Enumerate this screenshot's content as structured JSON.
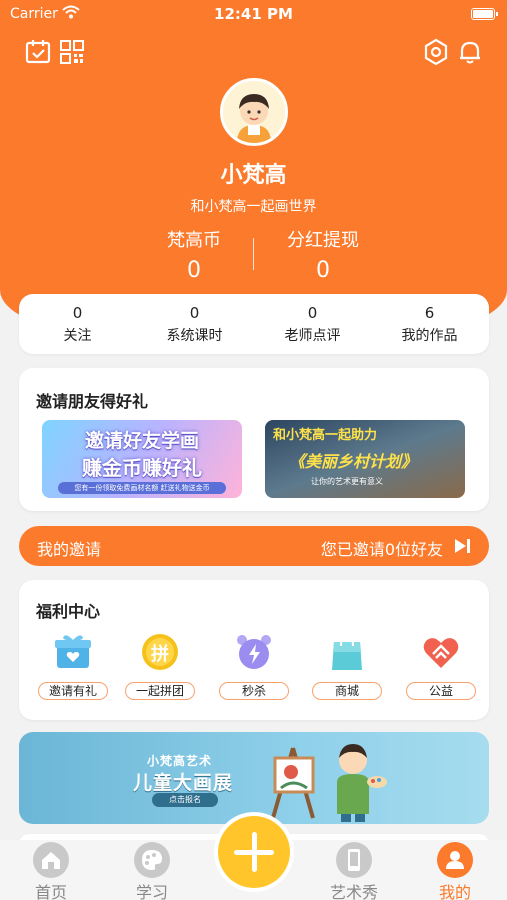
{
  "status_bar": {
    "carrier": "Carrier",
    "time": "12:41 PM"
  },
  "header": {
    "username": "小梵高",
    "slogan": "和小梵高一起画世界",
    "coins_label": "梵高币",
    "coins_value": "0",
    "dividend_label": "分红提现",
    "dividend_value": "0"
  },
  "stats": [
    {
      "value": "0",
      "label": "关注"
    },
    {
      "value": "0",
      "label": "系统课时"
    },
    {
      "value": "0",
      "label": "老师点评"
    },
    {
      "value": "6",
      "label": "我的作品"
    }
  ],
  "invite_section": {
    "title": "邀请朋友得好礼",
    "banner1": {
      "line1": "邀请好友学画",
      "line2": "赚金币赚好礼",
      "line3": "您有一份领取免费画材名额 赶送礼物送金币"
    },
    "banner2": {
      "line1": "和小梵高一起助力",
      "line2": "《美丽乡村计划》",
      "line3": "让你的艺术更有意义"
    }
  },
  "my_invite": {
    "label": "我的邀请",
    "status": "您已邀请0位好友"
  },
  "welfare": {
    "title": "福利中心",
    "items": [
      {
        "label": "邀请有礼",
        "icon": "gift-icon",
        "color": "#4fb3e8"
      },
      {
        "label": "一起拼团",
        "icon": "group-buy-icon",
        "color": "#f5c21b"
      },
      {
        "label": "秒杀",
        "icon": "alarm-clock-icon",
        "color": "#9b8cf0"
      },
      {
        "label": "商城",
        "icon": "shopping-bag-icon",
        "color": "#5ccbd8"
      },
      {
        "label": "公益",
        "icon": "heart-hands-icon",
        "color": "#f0624f"
      }
    ],
    "group_buy_glyph": "拼"
  },
  "exhibit": {
    "line1": "小梵高艺术",
    "line2": "儿童大画展",
    "line3": "点击报名"
  },
  "tabbar": {
    "tabs": [
      {
        "label": "首页",
        "icon": "home-icon"
      },
      {
        "label": "学习",
        "icon": "palette-icon"
      },
      {
        "label": "艺术秀",
        "icon": "phone-icon"
      },
      {
        "label": "我的",
        "icon": "profile-icon"
      }
    ],
    "center_icon": "plus-icon"
  },
  "colors": {
    "accent": "#fb7a2c",
    "plus": "#ffc52a"
  }
}
